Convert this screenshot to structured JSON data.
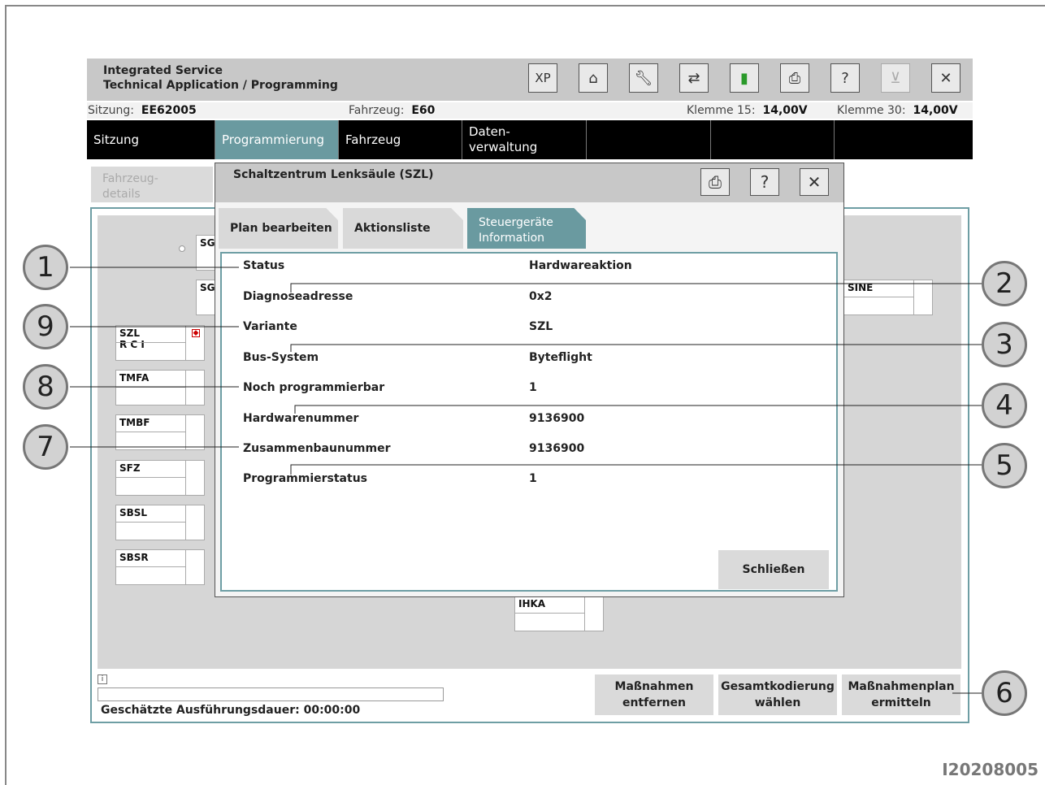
{
  "app": {
    "title_line1": "Integrated Service",
    "title_line2": "Technical Application / Programming",
    "xp_label": "XP"
  },
  "infobar": {
    "session_label": "Sitzung:",
    "session_value": "EE62005",
    "vehicle_label": "Fahrzeug:",
    "vehicle_value": "E60",
    "k15_label": "Klemme 15:",
    "k15_value": "14,00V",
    "k30_label": "Klemme 30:",
    "k30_value": "14,00V"
  },
  "menu": {
    "sitzung": "Sitzung",
    "programmierung": "Programmierung",
    "fahrzeug": "Fahrzeug",
    "daten_line1": "Daten-",
    "daten_line2": "verwaltung"
  },
  "subtab": {
    "line1": "Fahrzeug-",
    "line2": "details"
  },
  "ecus": {
    "sg1": "SG",
    "sg2": "SG",
    "szl": "SZL",
    "rci": "R C I",
    "tmfa": "TMFA",
    "tmbf": "TMBF",
    "sfz": "SFZ",
    "sbsl": "SBSL",
    "sbsr": "SBSR",
    "sine": "SINE",
    "ihka": "IHKA"
  },
  "dialog": {
    "title": "Schaltzentrum Lenksäule (SZL)",
    "tabs": {
      "plan": "Plan bearbeiten",
      "aktionsliste": "Aktionsliste",
      "sg_line1": "Steuergeräte",
      "sg_line2": "Information"
    },
    "rows": [
      {
        "label": "Status",
        "value": "Hardwareaktion"
      },
      {
        "label": "Diagnoseadresse",
        "value": "0x2"
      },
      {
        "label": "Variante",
        "value": "SZL"
      },
      {
        "label": "Bus-System",
        "value": "Byteflight"
      },
      {
        "label": "Noch programmierbar",
        "value": "1"
      },
      {
        "label": "Hardwarenummer",
        "value": "9136900"
      },
      {
        "label": "Zusammenbaunummer",
        "value": "9136900"
      },
      {
        "label": "Programmierstatus",
        "value": "1"
      }
    ],
    "close_label": "Schließen"
  },
  "bottom": {
    "info_glyph": "i",
    "duration_text": "Geschätzte Ausführungsdauer: 00:00:00",
    "btn_remove_line1": "Maßnahmen",
    "btn_remove_line2": "entfernen",
    "btn_coding_line1": "Gesamtkodierung",
    "btn_coding_line2": "wählen",
    "btn_plan_line1": "Maßnahmenplan",
    "btn_plan_line2": "ermitteln"
  },
  "callouts": [
    "1",
    "2",
    "3",
    "4",
    "5",
    "6",
    "7",
    "8",
    "9"
  ],
  "figure_code": "I20208005",
  "colors": {
    "accent": "#6a9aa0",
    "menubar": "#000000",
    "titlebar": "#c8c8c8"
  }
}
